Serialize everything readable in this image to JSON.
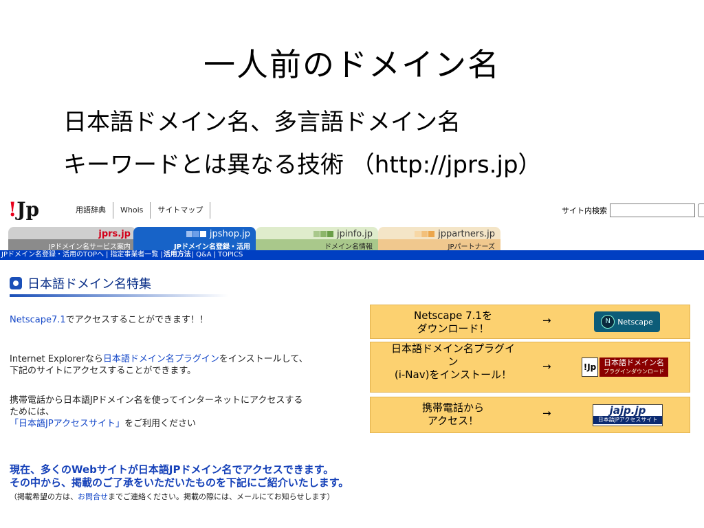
{
  "slide": {
    "title": "一人前のドメイン名",
    "subtitle_line1": "日本語ドメイン名、多言語ドメイン名",
    "subtitle_line2": "キーワードとは異なる技術 （http://jprs.jp）"
  },
  "site": {
    "logo": "!Jp",
    "topnav": [
      "用語辞典",
      "Whois",
      "サイトマップ"
    ],
    "search_label": "サイト内検索",
    "search_value": "",
    "tabs": [
      {
        "name": "jprs.jp",
        "desc": "JPドメイン名サービス案内"
      },
      {
        "name": "jpshop.jp",
        "desc": "JPドメイン名登録・活用"
      },
      {
        "name": "jpinfo.jp",
        "desc": "ドメイン名情報"
      },
      {
        "name": "jppartners.jp",
        "desc": "JPパートナーズ"
      }
    ],
    "subnav": [
      "JPドメイン名登録・活用のTOPへ",
      "指定事業者一覧",
      "活用方法",
      "Q&A",
      "TOPICS"
    ],
    "section_title": "日本語ドメイン名特集",
    "rows": [
      {
        "text_before": "Netscape7.1",
        "text_after": "でアクセスすることができます！！",
        "box_line1": "Netscape 7.1を",
        "box_line2": "ダウンロード！",
        "arrow": "→",
        "badge": "Netscape"
      },
      {
        "text_line1_a": "Internet Explorerなら",
        "text_line1_link": "日本語ドメイン名プラグイン",
        "text_line1_b": "をインストールして、",
        "text_line2": "下記のサイトにアクセスすることができます。",
        "box_line1": "日本語ドメイン名プラグイ",
        "box_line2": "ン",
        "box_line3": "(i-Nav)をインストール！",
        "arrow": "→",
        "badge_jp": "!Jp",
        "badge_main": "日本語ドメイン名",
        "badge_sub": "プラグインダウンロード"
      },
      {
        "text_line1": "携帯電話から日本語JPドメイン名を使ってインターネットにアクセスする",
        "text_line2": "ためには、",
        "text_line3_link": "「日本語JPアクセスサイト」",
        "text_line3_b": "をご利用ください",
        "box_line1": "携帯電話から",
        "box_line2": "アクセス！",
        "arrow": "→",
        "badge_main": "jajp.jp",
        "badge_sub": "日本語JPアクセスサイト"
      }
    ],
    "announce_line1": "現在、多くのWebサイトが日本語JPドメイン名でアクセスできます。",
    "announce_line2": "その中から、掲載のご了承をいただいたものを下記にご紹介いたします。",
    "note_a": "（掲載希望の方は、",
    "note_link": "お問合せ",
    "note_b": "までご連絡ください。掲載の際には、メールにてお知らせします）"
  }
}
